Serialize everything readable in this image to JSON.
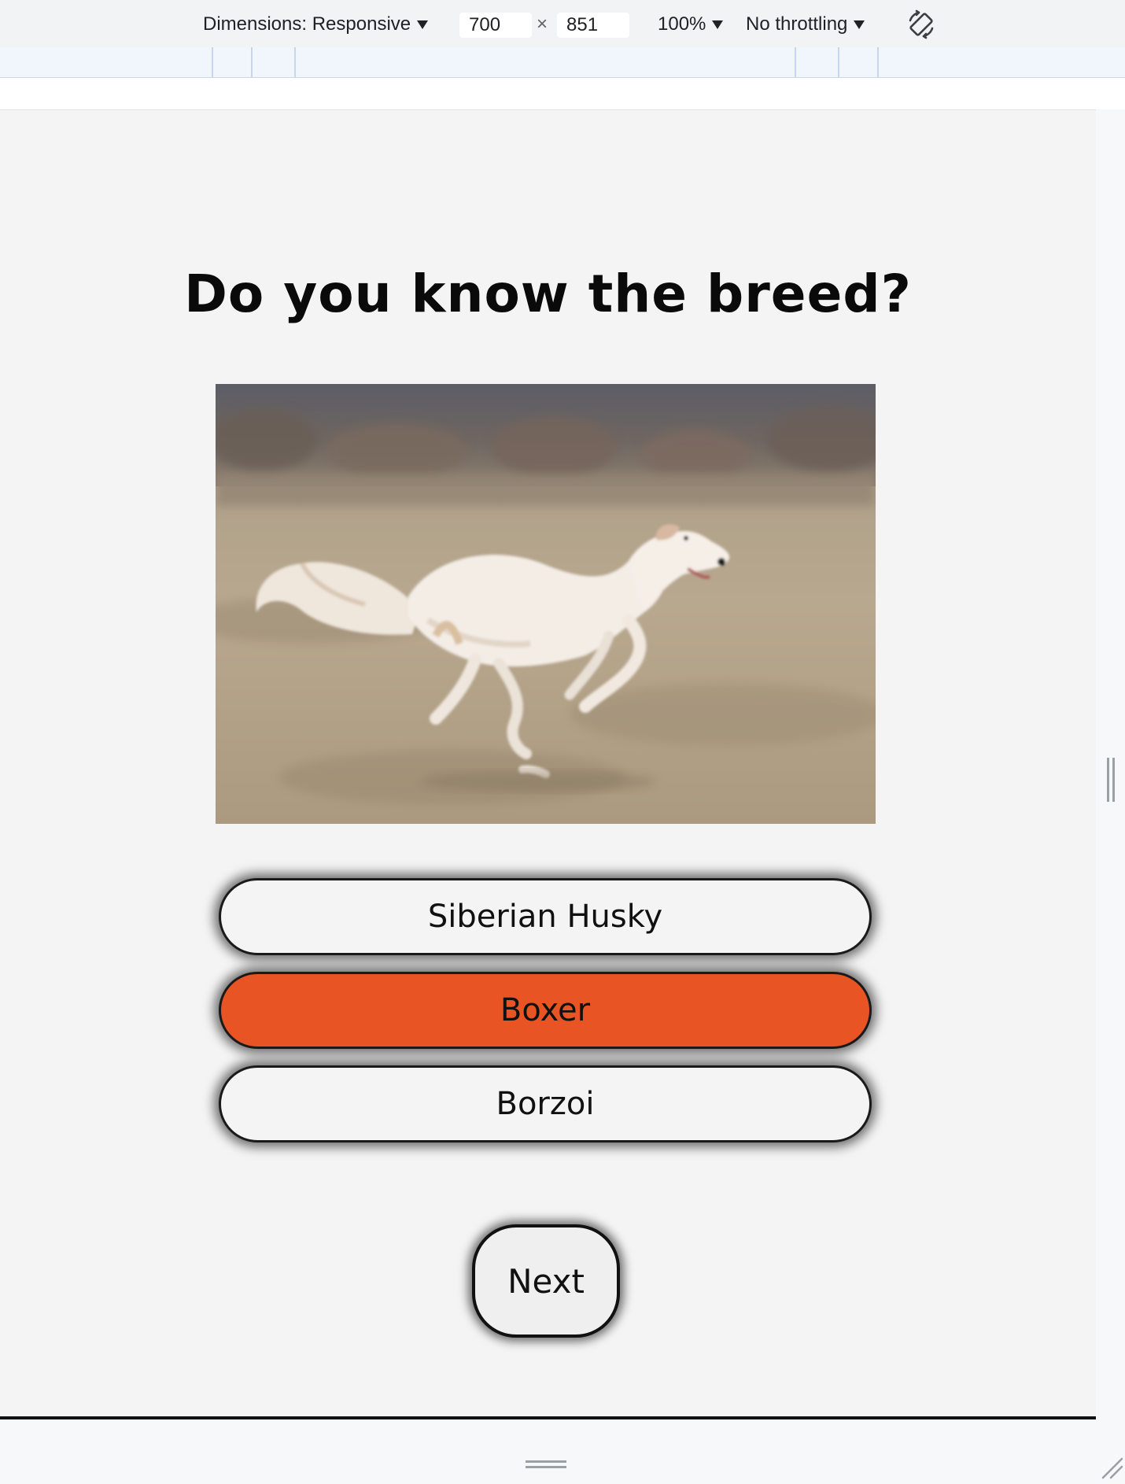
{
  "devtools": {
    "dimensions_label": "Dimensions: Responsive",
    "width_value": "700",
    "times_sign": "×",
    "height_value": "851",
    "zoom_label": "100%",
    "throttling_label": "No throttling",
    "rotate_icon": "rotate-icon"
  },
  "quiz": {
    "title": "Do you know the breed?",
    "image_alt": "white borzoi dog running on a field",
    "answers": [
      {
        "label": "Siberian Husky",
        "state": "default"
      },
      {
        "label": "Boxer",
        "state": "selected"
      },
      {
        "label": "Borzoi",
        "state": "default"
      }
    ],
    "next_label": "Next"
  },
  "colors": {
    "selected_answer": "#e95424",
    "page_background": "#f4f4f4",
    "toolbar_background": "#f1f3f4"
  }
}
